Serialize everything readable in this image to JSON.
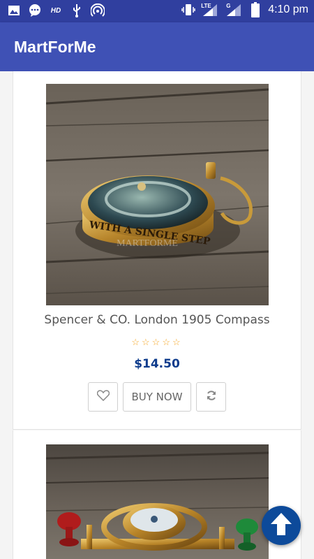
{
  "status_bar": {
    "time": "4:10 pm",
    "hd_label": "HD",
    "lte_label": "LTE",
    "g_label": "G",
    "left_icons": [
      "image-icon",
      "chat-icon",
      "hd-icon",
      "usb-icon",
      "hotspot-icon"
    ],
    "right_icons": [
      "vibrate-icon",
      "signal-icon",
      "signal-icon",
      "battery-icon"
    ]
  },
  "appbar": {
    "title": "MartForMe"
  },
  "products": [
    {
      "name": "Spencer & CO. London 1905 Compass",
      "price": "$14.50",
      "rating": 0,
      "stars": "☆☆☆☆☆",
      "image_text": "WITH A SINGLE STEP",
      "watermark": "MARTFORME",
      "buttons": {
        "wishlist": "heart-icon",
        "buy": "BUY NOW",
        "compare": "refresh-icon"
      }
    },
    {
      "name": "",
      "image_description": "brass gimbal compass with red and green knobs"
    }
  ],
  "fab": {
    "icon": "arrow-up-icon"
  },
  "colors": {
    "status_bar": "#303F9F",
    "app_bar": "#3F51B5",
    "price": "#0d3b8c",
    "stars": "#f5a623",
    "fab": "#0d4a9a"
  }
}
